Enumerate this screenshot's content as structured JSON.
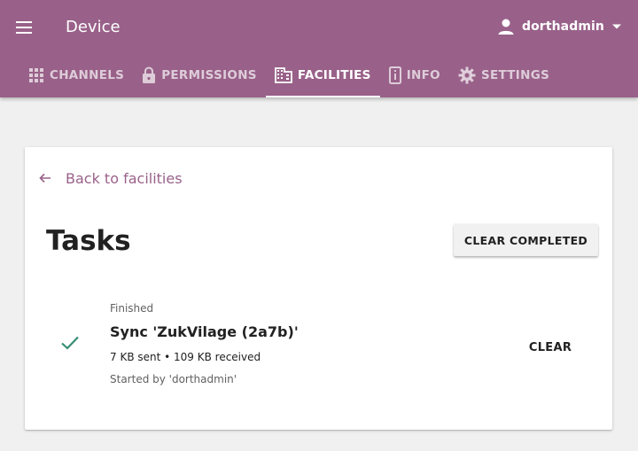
{
  "header": {
    "title": "Device",
    "user": {
      "name": "dorthadmin"
    }
  },
  "tabs": [
    {
      "label": "CHANNELS",
      "icon": "grid-icon",
      "active": false
    },
    {
      "label": "PERMISSIONS",
      "icon": "lock-icon",
      "active": false
    },
    {
      "label": "FACILITIES",
      "icon": "building-icon",
      "active": true
    },
    {
      "label": "INFO",
      "icon": "info-icon",
      "active": false
    },
    {
      "label": "SETTINGS",
      "icon": "gear-icon",
      "active": false
    }
  ],
  "main": {
    "back_label": "Back to facilities",
    "title": "Tasks",
    "clear_completed_label": "CLEAR COMPLETED",
    "task": {
      "status": "Finished",
      "name": "Sync 'ZukVilage (2a7b)'",
      "progress": "7 KB sent • 109 KB received",
      "started_by": "Started by 'dorthadmin'",
      "clear_label": "CLEAR"
    }
  },
  "colors": {
    "brand": "#996189",
    "success": "#368d74",
    "background": "#f0f0f0"
  }
}
